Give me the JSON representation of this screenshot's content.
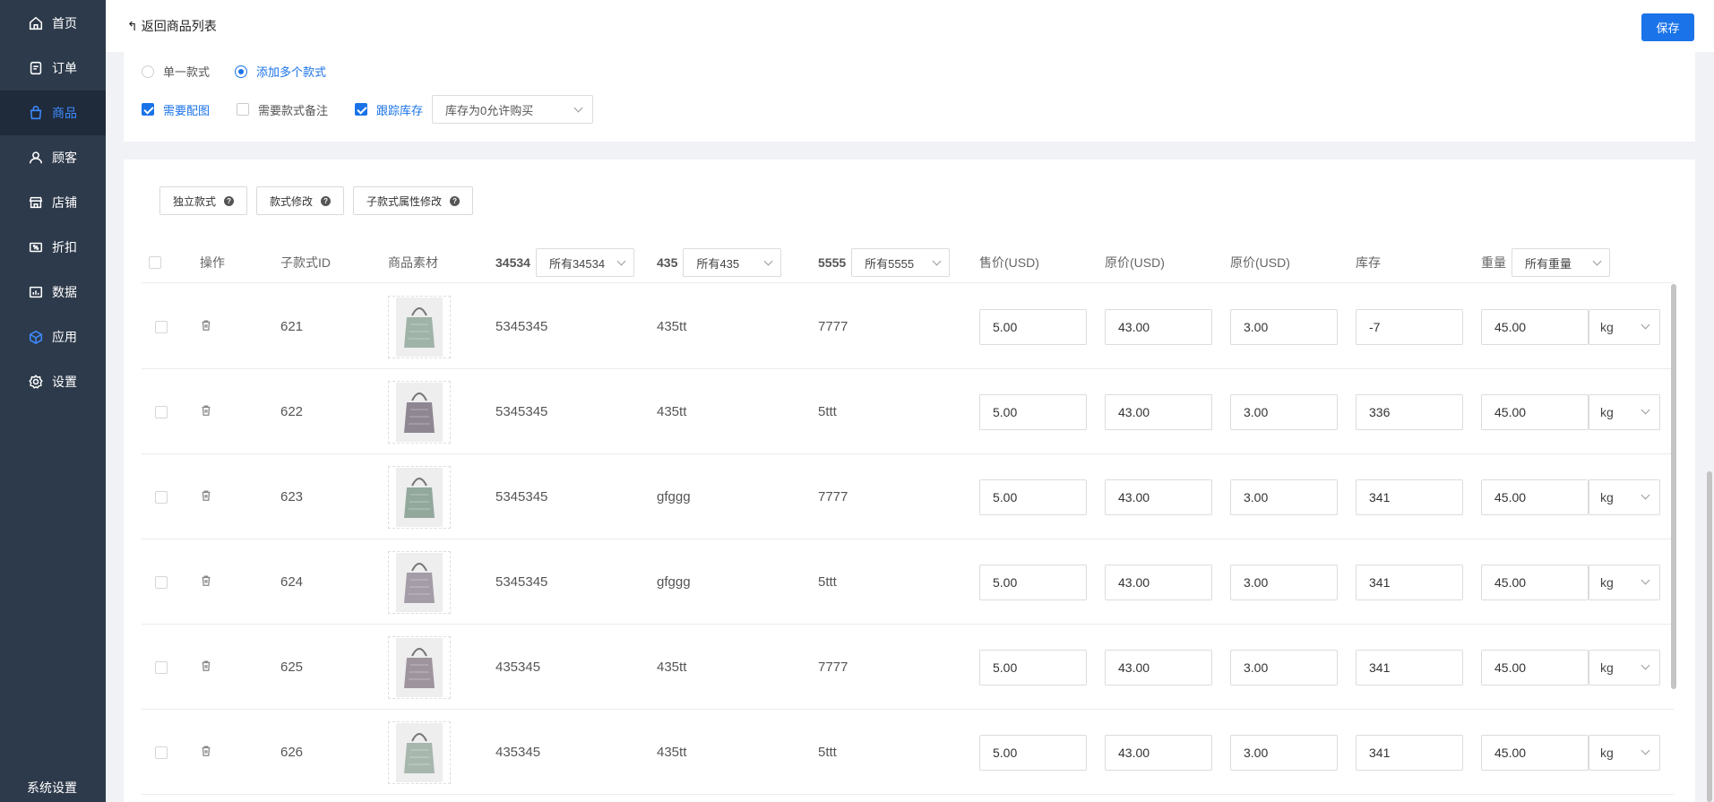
{
  "sidebar": {
    "items": [
      {
        "label": "首页",
        "icon": "home-icon"
      },
      {
        "label": "订单",
        "icon": "order-icon"
      },
      {
        "label": "商品",
        "icon": "bag-icon",
        "active": true
      },
      {
        "label": "顾客",
        "icon": "user-icon"
      },
      {
        "label": "店铺",
        "icon": "store-icon"
      },
      {
        "label": "折扣",
        "icon": "discount-icon"
      },
      {
        "label": "数据",
        "icon": "chart-icon"
      },
      {
        "label": "应用",
        "icon": "cube-icon"
      },
      {
        "label": "设置",
        "icon": "gear-icon"
      }
    ],
    "bottom_label": "系统设置"
  },
  "header": {
    "back_label": "返回商品列表",
    "save_label": "保存"
  },
  "variant_mode": {
    "options": [
      "单一款式",
      "添加多个款式"
    ],
    "selected": "添加多个款式"
  },
  "options": {
    "need_image": {
      "label": "需要配图",
      "checked": true
    },
    "need_note": {
      "label": "需要款式备注",
      "checked": false
    },
    "track_stock": {
      "label": "跟踪库存",
      "checked": true
    },
    "stock_policy": "库存为0允许购买"
  },
  "toolbar": {
    "buttons": [
      "独立款式",
      "款式修改",
      "子款式属性修改"
    ]
  },
  "table": {
    "headers": {
      "action": "操作",
      "sub_id": "子款式ID",
      "material": "商品素材",
      "attr1_name": "34534",
      "attr1_filter": "所有34534",
      "attr2_name": "435",
      "attr2_filter": "所有435",
      "attr3_name": "5555",
      "attr3_filter": "所有5555",
      "sale_price": "售价(USD)",
      "orig_price": "原价(USD)",
      "orig_price2": "原价(USD)",
      "stock": "库存",
      "weight": "重量",
      "weight_filter": "所有重量"
    },
    "rows": [
      {
        "id": "621",
        "a1": "5345345",
        "a2": "435tt",
        "a3": "7777",
        "sale": "5.00",
        "orig": "43.00",
        "orig2": "3.00",
        "stock": "-7",
        "weight": "45.00",
        "unit": "kg",
        "img_color": "#9fb3a8"
      },
      {
        "id": "622",
        "a1": "5345345",
        "a2": "435tt",
        "a3": "5ttt",
        "sale": "5.00",
        "orig": "43.00",
        "orig2": "3.00",
        "stock": "336",
        "weight": "45.00",
        "unit": "kg",
        "img_color": "#8e8691"
      },
      {
        "id": "623",
        "a1": "5345345",
        "a2": "gfggg",
        "a3": "7777",
        "sale": "5.00",
        "orig": "43.00",
        "orig2": "3.00",
        "stock": "341",
        "weight": "45.00",
        "unit": "kg",
        "img_color": "#93a89d"
      },
      {
        "id": "624",
        "a1": "5345345",
        "a2": "gfggg",
        "a3": "5ttt",
        "sale": "5.00",
        "orig": "43.00",
        "orig2": "3.00",
        "stock": "341",
        "weight": "45.00",
        "unit": "kg",
        "img_color": "#a49ca6"
      },
      {
        "id": "625",
        "a1": "435345",
        "a2": "435tt",
        "a3": "7777",
        "sale": "5.00",
        "orig": "43.00",
        "orig2": "3.00",
        "stock": "341",
        "weight": "45.00",
        "unit": "kg",
        "img_color": "#9e949e"
      },
      {
        "id": "626",
        "a1": "435345",
        "a2": "435tt",
        "a3": "5ttt",
        "sale": "5.00",
        "orig": "43.00",
        "orig2": "3.00",
        "stock": "341",
        "weight": "45.00",
        "unit": "kg",
        "img_color": "#a8b7ae"
      }
    ]
  },
  "colors": {
    "sidebar_bg": "#2d3a4b",
    "accent": "#1a73e8"
  }
}
